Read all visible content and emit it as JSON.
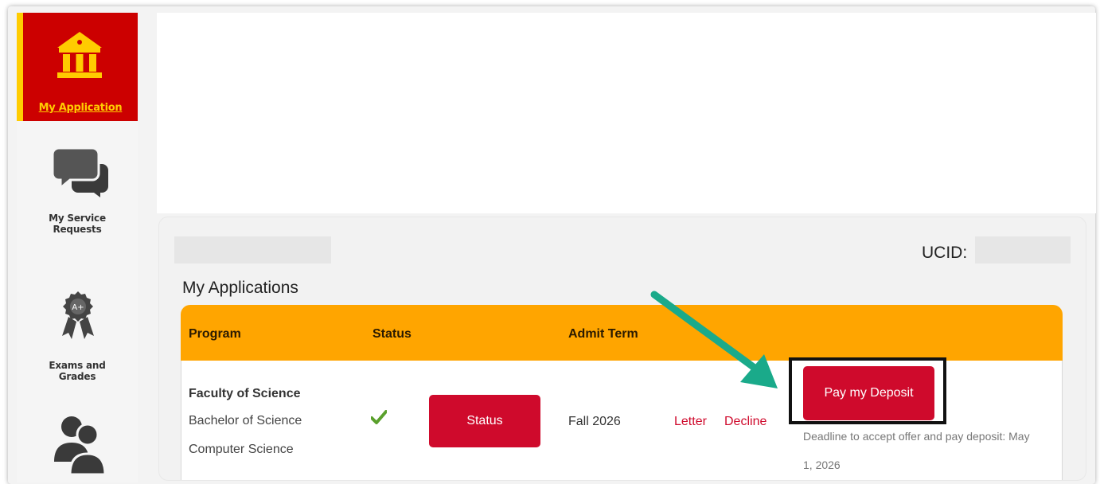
{
  "sidebar": {
    "items": [
      {
        "label": "My Application",
        "icon": "institution-icon",
        "active": true
      },
      {
        "label_line1": "My Service",
        "label_line2": "Requests",
        "icon": "chat-bubbles-icon"
      },
      {
        "label_line1": "Exams and",
        "label_line2": "Grades",
        "icon": "award-ribbon-icon"
      },
      {
        "icon": "users-icon"
      }
    ]
  },
  "header": {
    "ucid_label": "UCID:"
  },
  "applications": {
    "title": "My Applications",
    "columns": [
      "Program",
      "Status",
      "Admit Term"
    ],
    "rows": [
      {
        "faculty": "Faculty of Science",
        "degree": "Bachelor of Science",
        "major": "Computer Science",
        "status_icon": "checkmark-icon",
        "status_button": "Status",
        "admit_term": "Fall 2026",
        "letter_link": "Letter",
        "decline_link": "Decline",
        "deposit_button": "Pay my Deposit",
        "deadline_text": "Deadline to accept offer and pay deposit: May 1, 2026"
      }
    ]
  },
  "colors": {
    "brand_red": "#cc0000",
    "accent_gold": "#ffcc00",
    "table_header_orange": "#ffa500",
    "button_red": "#cf0a2c",
    "annotation_arrow": "#1aaa8a"
  }
}
